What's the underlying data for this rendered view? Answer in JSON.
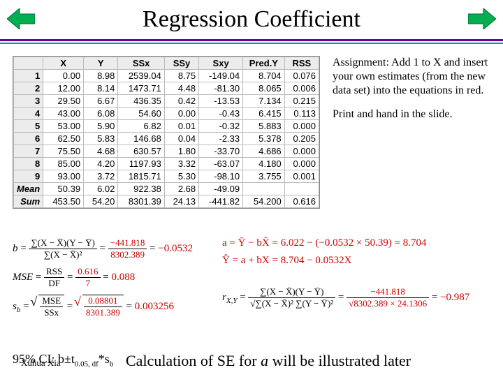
{
  "nav": {
    "prev_icon": "nav-prev-arrow",
    "next_icon": "nav-next-arrow"
  },
  "title": "Regression Coefficient",
  "colors": {
    "purple": "#660099",
    "teal": "#009999",
    "red": "#cc0000"
  },
  "table": {
    "columns": [
      "",
      "X",
      "Y",
      "SSx",
      "SSy",
      "Sxy",
      "Pred.Y",
      "RSS"
    ],
    "rows": [
      {
        "label": "1",
        "X": "0.00",
        "Y": "8.98",
        "SSx": "2539.04",
        "SSy": "8.75",
        "Sxy": "-149.04",
        "PredY": "8.704",
        "RSS": "0.076"
      },
      {
        "label": "2",
        "X": "12.00",
        "Y": "8.14",
        "SSx": "1473.71",
        "SSy": "4.48",
        "Sxy": "-81.30",
        "PredY": "8.065",
        "RSS": "0.006"
      },
      {
        "label": "3",
        "X": "29.50",
        "Y": "6.67",
        "SSx": "436.35",
        "SSy": "0.42",
        "Sxy": "-13.53",
        "PredY": "7.134",
        "RSS": "0.215"
      },
      {
        "label": "4",
        "X": "43.00",
        "Y": "6.08",
        "SSx": "54.60",
        "SSy": "0.00",
        "Sxy": "-0.43",
        "PredY": "6.415",
        "RSS": "0.113"
      },
      {
        "label": "5",
        "X": "53.00",
        "Y": "5.90",
        "SSx": "6.82",
        "SSy": "0.01",
        "Sxy": "-0.32",
        "PredY": "5.883",
        "RSS": "0.000"
      },
      {
        "label": "6",
        "X": "62.50",
        "Y": "5.83",
        "SSx": "146.68",
        "SSy": "0.04",
        "Sxy": "-2.33",
        "PredY": "5.378",
        "RSS": "0.205"
      },
      {
        "label": "7",
        "X": "75.50",
        "Y": "4.68",
        "SSx": "630.57",
        "SSy": "1.80",
        "Sxy": "-33.70",
        "PredY": "4.686",
        "RSS": "0.000"
      },
      {
        "label": "8",
        "X": "85.00",
        "Y": "4.20",
        "SSx": "1197.93",
        "SSy": "3.32",
        "Sxy": "-63.07",
        "PredY": "4.180",
        "RSS": "0.000"
      },
      {
        "label": "9",
        "X": "93.00",
        "Y": "3.72",
        "SSx": "1815.71",
        "SSy": "5.30",
        "Sxy": "-98.10",
        "PredY": "3.755",
        "RSS": "0.001"
      }
    ],
    "mean": {
      "label": "Mean",
      "X": "50.39",
      "Y": "6.02",
      "SSx": "922.38",
      "SSy": "2.68",
      "Sxy": "-49.09",
      "PredY": "",
      "RSS": ""
    },
    "sum": {
      "label": "Sum",
      "X": "453.50",
      "Y": "54.20",
      "SSx": "8301.39",
      "SSy": "24.13",
      "Sxy": "-441.82",
      "PredY": "54.200",
      "RSS": "0.616"
    }
  },
  "sidebox": {
    "p1": "Assignment: Add 1 to X and insert your own estimates (from the new data set) into the equations in red.",
    "p2": "Print and hand in the slide."
  },
  "equations": {
    "b_num_text": "∑(X − X̄)(Y − Ȳ)",
    "b_den_text": "∑(X − X̄)²",
    "b_num_val": "−441.818",
    "b_den_val": "8302.389",
    "b_result": "−0.0532",
    "mse_num": "RSS",
    "mse_den": "DF",
    "mse_num_val": "0.616",
    "mse_den_val": "7",
    "mse_result": "0.088",
    "sb_inner_num": "MSE",
    "sb_inner_den": "SSx",
    "sb_val_num": "0.08801",
    "sb_val_den": "8301.389",
    "sb_result": "0.003256",
    "a_expr": "a = Ȳ − bX̄ = 6.022 − (−0.0532 × 50.39) = 8.704",
    "yhat_expr": "Ŷ = a + bX = 8.704 − 0.0532X",
    "r_label": "r",
    "r_sub": "X,Y",
    "r_num": "∑(X − X̄)(Y − Ȳ)",
    "r_den": "√∑(X − X̄)² ∑(Y − Ȳ)²",
    "r_val_num": "−441.818",
    "r_val_den": "√8302.389 × 24.1306",
    "r_result": "−0.987"
  },
  "ci": {
    "text_prefix": "95% CI: b±t",
    "sub": "0.05, df",
    "suffix": "*s",
    "suffix_sub": "b"
  },
  "author": "Xuhua Xia",
  "footline_prefix": "Calculation of SE for ",
  "footline_var": "a",
  "footline_suffix": " will be illustrated later"
}
